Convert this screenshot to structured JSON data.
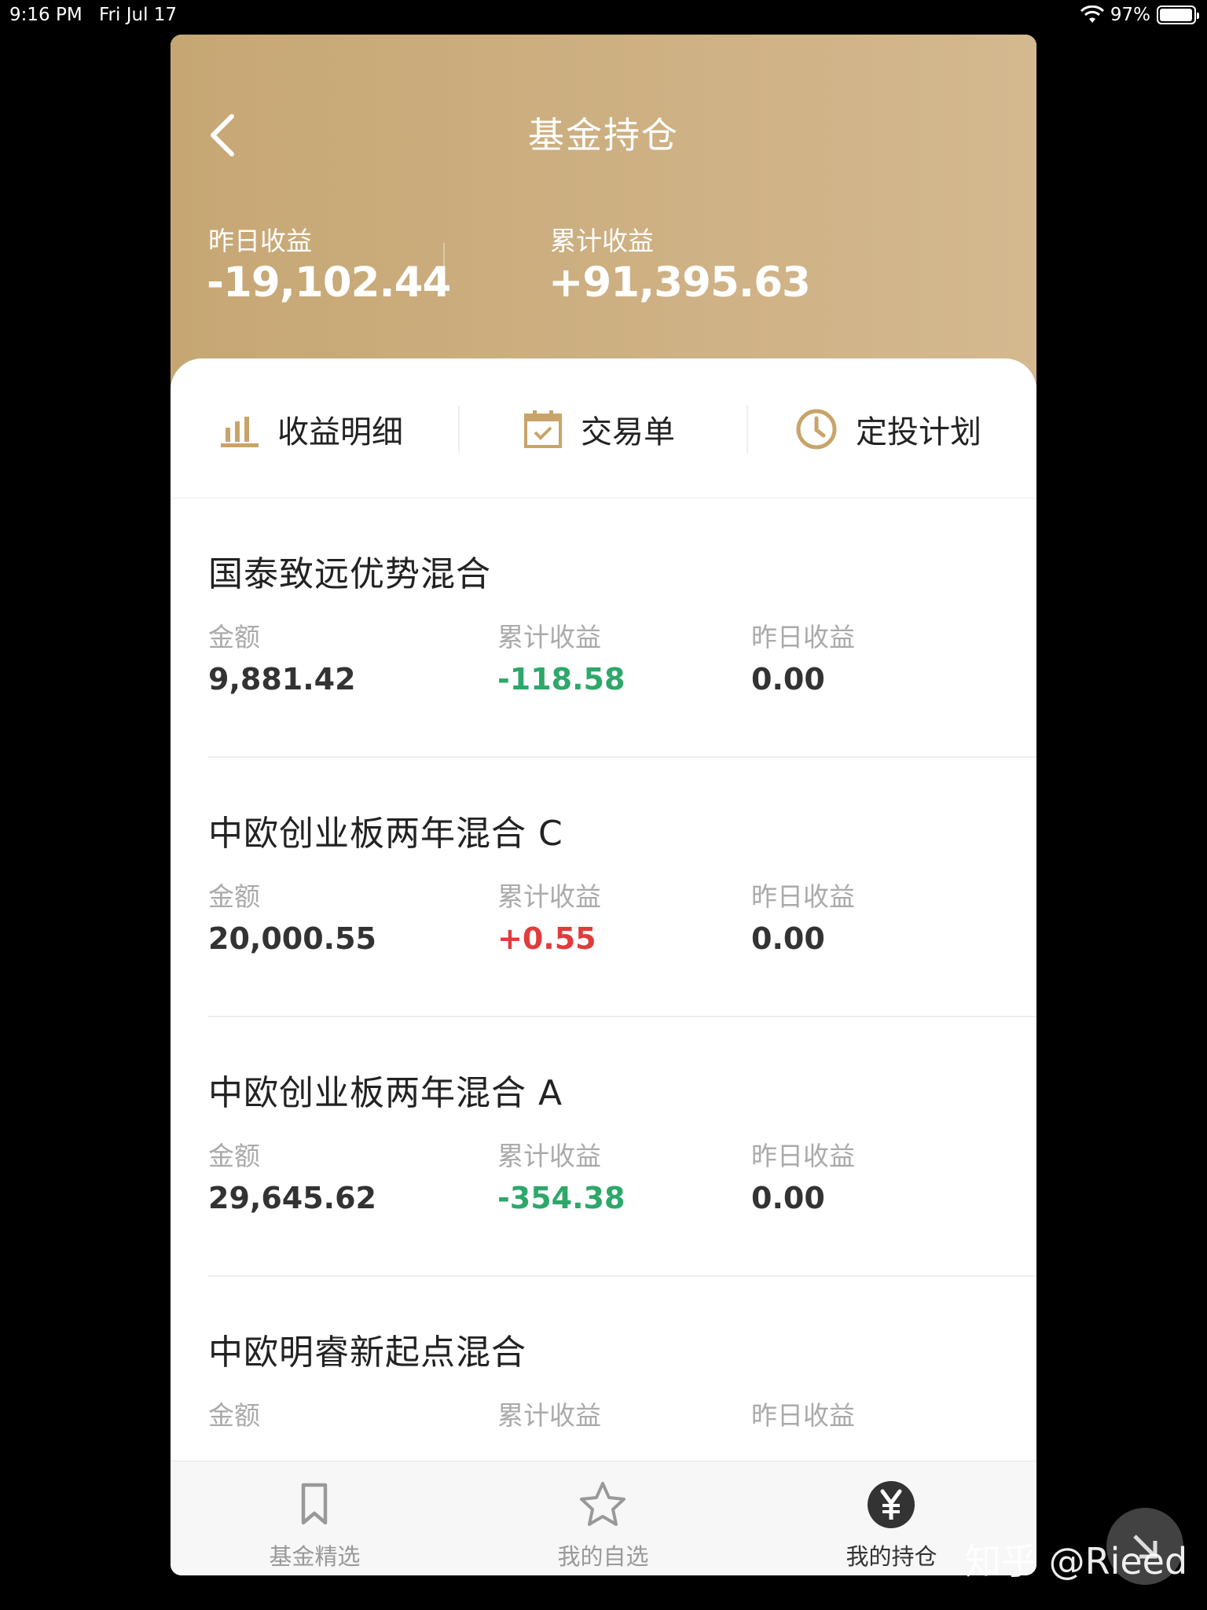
{
  "status_bar": {
    "time": "9:16 PM",
    "date": "Fri Jul 17",
    "battery": "97%",
    "battery_level": 0.97
  },
  "header": {
    "title": "基金持仓",
    "yesterday_label": "昨日收益",
    "yesterday_value": "-19,102.44",
    "total_label": "累计收益",
    "total_value": "+91,395.63"
  },
  "actions": [
    {
      "label": "收益明细",
      "icon": "bar-chart-icon"
    },
    {
      "label": "交易单",
      "icon": "calendar-check-icon"
    },
    {
      "label": "定投计划",
      "icon": "clock-icon"
    }
  ],
  "funds": [
    {
      "name": "国泰致远优势混合",
      "amount_label": "金额",
      "amount": "9,881.42",
      "total_label": "累计收益",
      "total": "-118.58",
      "yesterday_label": "昨日收益",
      "yesterday": "0.00"
    },
    {
      "name": "中欧创业板两年混合 C",
      "amount_label": "金额",
      "amount": "20,000.55",
      "total_label": "累计收益",
      "total": "+0.55",
      "yesterday_label": "昨日收益",
      "yesterday": "0.00"
    },
    {
      "name": "中欧创业板两年混合 A",
      "amount_label": "金额",
      "amount": "29,645.62",
      "total_label": "累计收益",
      "total": "-354.38",
      "yesterday_label": "昨日收益",
      "yesterday": "0.00"
    },
    {
      "name": "中欧明睿新起点混合",
      "amount_label": "金额",
      "amount": "",
      "total_label": "累计收益",
      "total": "",
      "yesterday_label": "昨日收益",
      "yesterday": ""
    }
  ],
  "tabs": [
    {
      "label": "基金精选",
      "icon": "bookmark-icon",
      "active": false
    },
    {
      "label": "我的自选",
      "icon": "star-icon",
      "active": false
    },
    {
      "label": "我的持仓",
      "icon": "yen-icon",
      "active": true
    }
  ],
  "watermark": "知乎 @Rieed",
  "colors": {
    "gold": "#c6a774",
    "positive": "#e03c3c",
    "negative": "#2ea86a"
  }
}
